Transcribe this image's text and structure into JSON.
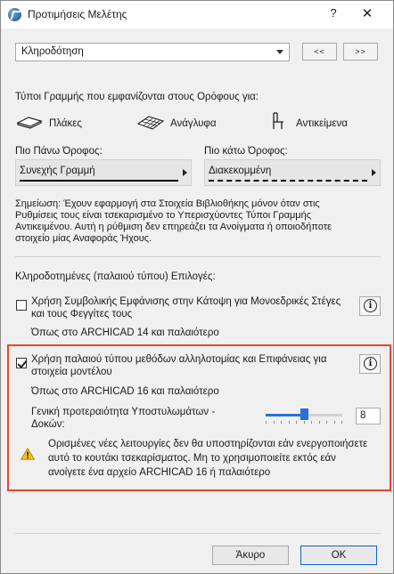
{
  "window": {
    "title": "Προτιμήσεις Μελέτης",
    "help_label": "?",
    "close_label": "✕"
  },
  "nav": {
    "selected_page": "Κληροδότηση",
    "prev_label": "<<",
    "next_label": ">>"
  },
  "line_types": {
    "heading": "Τύποι Γραμμής που εμφανίζονται στους Ορόφους για:",
    "items": [
      {
        "label": "Πλάκες",
        "icon": "slab-icon"
      },
      {
        "label": "Ανάγλυφα",
        "icon": "mesh-icon"
      },
      {
        "label": "Αντικείμενα",
        "icon": "object-icon"
      }
    ],
    "above_label": "Πιο Πάνω Όροφος:",
    "above_value": "Συνεχής Γραμμή",
    "below_label": "Πιο κάτω Όροφος:",
    "below_value": "Διακεκομμένη",
    "note_lines": [
      "Σημείωση: Έχουν εφαρμογή στα Στοιχεία Βιβλιοθήκης μόνον όταν στις",
      "Ρυθμίσεις τους είναι τσεκαρισμένο το Υπερισχύοντες Τύποι Γραμμής",
      "Αντικειμένου. Αυτή η ρύθμιση δεν επηρεάζει τα Ανοίγματα ή οποιοδήποτε",
      "στοιχείο μίας Αναφοράς Ήχους."
    ]
  },
  "legacy": {
    "heading": "Κληροδοτημένες (παλαιού τύπου) Επιλογές:",
    "option1": {
      "checked": false,
      "label_lines": [
        "Χρήση Συμβολικής Εμφάνισης στην Κάτοψη για Μονοεδρικές Στέγες",
        "και τους Φεγγίτες τους"
      ],
      "sub": "Όπως στο ARCHICAD 14 και παλαιότερο",
      "info": "i"
    },
    "option2": {
      "checked": true,
      "label_lines": [
        "Χρήση παλαιού τύπου μεθόδων αλληλοτομίας και Επιφάνειας για",
        "στοιχεία μοντέλου"
      ],
      "sub": "Όπως στο ARCHICAD 16 και παλαιότερο",
      "info": "i",
      "priority_label_lines": [
        "Γενική προτεραιότητα Υποστυλωμάτων -",
        "Δοκών:"
      ],
      "priority_value": "8",
      "priority_level_fraction": 0.5,
      "warning_lines": [
        "Ορισμένες νέες λειτουργίες δεν θα υποστηρίζονται εάν ενεργοποιήσετε",
        "αυτό το κουτάκι τσεκαρίσματος. Μη το χρησιμοποιείτε εκτός εάν",
        "ανοίγετε ένα αρχείο ARCHICAD 16 ή παλαιότερο"
      ]
    }
  },
  "footer": {
    "cancel_label": "Άκυρο",
    "ok_label": "OK"
  },
  "colors": {
    "highlight": "#e8462c",
    "slider": "#2a6fd6",
    "warning": "#f5c518"
  }
}
